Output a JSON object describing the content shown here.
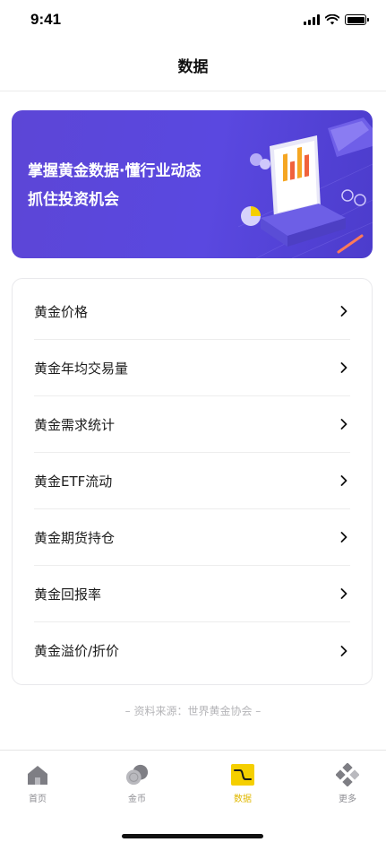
{
  "status_bar": {
    "time": "9:41"
  },
  "header": {
    "title": "数据"
  },
  "banner": {
    "line1": "掌握黄金数据·懂行业动态",
    "line2": "抓住投资机会"
  },
  "menu": {
    "items": [
      {
        "label": "黄金价格"
      },
      {
        "label": "黄金年均交易量"
      },
      {
        "label": "黄金需求统计"
      },
      {
        "label": "黄金ETF流动"
      },
      {
        "label": "黄金期货持仓"
      },
      {
        "label": "黄金回报率"
      },
      {
        "label": "黄金溢价/折价"
      }
    ]
  },
  "footer_note": "– 资料来源：世界黄金协会 –",
  "tab_bar": {
    "tabs": [
      {
        "label": "首页",
        "icon": "home-icon"
      },
      {
        "label": "金币",
        "icon": "coins-icon"
      },
      {
        "label": "数据",
        "icon": "data-chart-icon",
        "active": true
      },
      {
        "label": "更多",
        "icon": "more-grid-icon"
      }
    ]
  },
  "colors": {
    "banner": "#5a48e0",
    "accent": "#f5cf00",
    "active_label": "#e0b800",
    "inactive": "#8e8e93"
  }
}
